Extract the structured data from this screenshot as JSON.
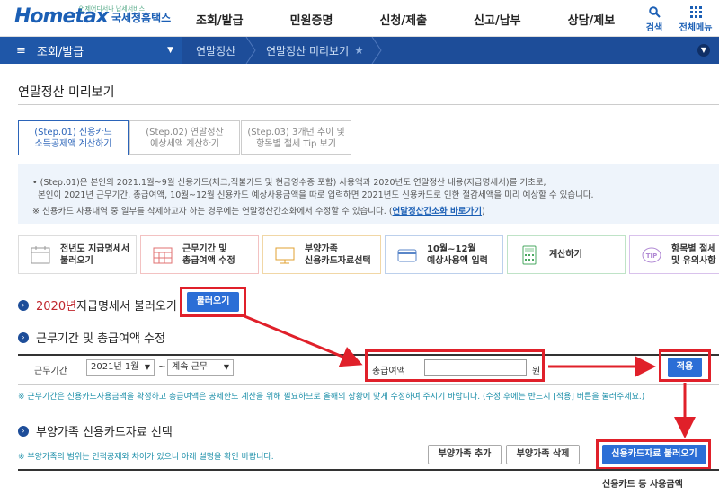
{
  "header": {
    "logo_text": "Hometax",
    "logo_sub": "국세청홈택스",
    "logo_tagline": "언제어디서나 납세서비스",
    "gnb": [
      "조회/발급",
      "민원증명",
      "신청/제출",
      "신고/납부",
      "상담/제보"
    ],
    "search_label": "검색",
    "allmenu_label": "전체메뉴"
  },
  "navbar": {
    "menu_label": "조회/발급",
    "crumbs": [
      "연말정산",
      "연말정산 미리보기"
    ]
  },
  "page": {
    "title": "연말정산 미리보기"
  },
  "tabs": [
    {
      "line1": "(Step.01) 신용카드",
      "line2": "소득공제액 계산하기"
    },
    {
      "line1": "(Step.02) 연말정산",
      "line2": "예상세액 계산하기"
    },
    {
      "line1": "(Step.03) 3개년 추이 및",
      "line2": "항목별 절세 Tip 보기"
    }
  ],
  "info": {
    "line1": "• (Step.01)은 본인의 2021.1월~9월 신용카드(체크,직불카드 및 현금영수증 포함) 사용액과 2020년도 연말정산 내용(지급명세서)를 기초로,",
    "line2": "본인이 2021년 근무기간, 총급여액, 10월~12월 신용카드 예상사용금액을 따로 입력하면 2021년도 신용카드로 인한 절감세액을 미리 예상할 수 있습니다.",
    "line3": "※ 신용카드 사용내역 중 일부를 삭제하고자 하는 경우에는 연말정산간소화에서 수정할 수 있습니다. (",
    "link": "연말정산간소화 바로가기",
    "line3_end": ")"
  },
  "steps": [
    {
      "line1": "전년도 지급명세서",
      "line2": "불러오기",
      "icon": "calendar-doc-icon"
    },
    {
      "line1": "근무기간 및",
      "line2": "총급여액 수정",
      "icon": "calendar-grid-icon"
    },
    {
      "line1": "부양가족",
      "line2": "신용카드자료선택",
      "icon": "monitor-icon"
    },
    {
      "line1": "10월~12월",
      "line2": "예상사용액 입력",
      "icon": "card-icon"
    },
    {
      "line1": "계산하기",
      "line2": "",
      "icon": "calculator-icon"
    },
    {
      "line1": "항목별 절세 팁",
      "line2": "및 유의사항",
      "icon": "tip-icon"
    }
  ],
  "section1": {
    "year": "2020년",
    "title": " 지급명세서 불러오기",
    "button": "불러오기"
  },
  "section2": {
    "title": "근무기간 및 총급여액 수정",
    "period_label": "근무기간",
    "start_value": "2021년 1월",
    "tilde": "~",
    "end_value": "계속 근무",
    "salary_label": "총급여액",
    "salary_value": "",
    "unit": "원",
    "apply_button": "적용",
    "note": "※ 근무기간은 신용카드사용금액을 확정하고 총급여액은 공제한도 계산을 위해 필요하므로 올해의 상황에 맞게 수정하여 주시기 바랍니다. (수정 후에는 반드시 [적용] 버튼을 눌러주세요.)"
  },
  "section3": {
    "title": "부양가족 신용카드자료 선택",
    "note": "※ 부양가족의 범위는 인적공제와 차이가 있으니 아래 설명을 확인 바랍니다.",
    "add_button": "부양가족 추가",
    "delete_button": "부양가족 삭제",
    "load_button": "신용카드자료 불러오기",
    "table_header": "신용카드 등 사용금액"
  },
  "colors": {
    "primary": "#1d4d99",
    "accent": "#2b6ed6",
    "highlight": "#e0202a"
  }
}
